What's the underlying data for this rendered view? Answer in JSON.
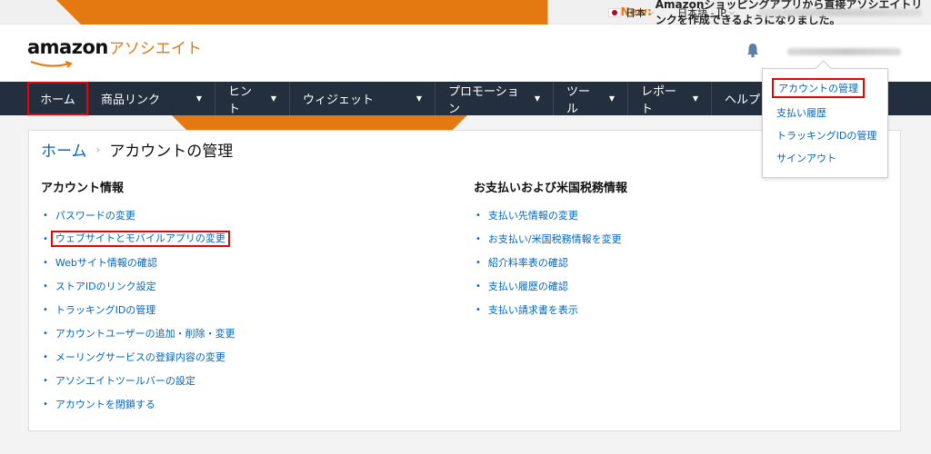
{
  "topbar": {
    "new_tag": "New:",
    "message": "Amazonショッピングアプリから直接アソシエイトリンクを作成できるようになりました。",
    "country": "日本",
    "language": "日本語 - JP"
  },
  "header": {
    "logo_text": "amazon",
    "logo_suffix": "アソシエイト"
  },
  "nav": {
    "home": "ホーム",
    "items": [
      "商品リンク",
      "ヒント",
      "ウィジェット",
      "プロモーション",
      "ツール",
      "レポート",
      "ヘルプ"
    ]
  },
  "breadcrumb": {
    "home": "ホーム",
    "separator": "›",
    "current": "アカウントの管理"
  },
  "account_info": {
    "heading": "アカウント情報",
    "links": [
      "パスワードの変更",
      "ウェブサイトとモバイルアプリの変更",
      "Webサイト情報の確認",
      "ストアIDのリンク設定",
      "トラッキングIDの管理",
      "アカウントユーザーの追加・削除・変更",
      "メーリングサービスの登録内容の変更",
      "アソシエイトツールバーの設定",
      "アカウントを閉鎖する"
    ]
  },
  "payment_info": {
    "heading": "お支払いおよび米国税務情報",
    "links": [
      "支払い先情報の変更",
      "お支払い/米国税務情報を変更",
      "紹介料率表の確認",
      "支払い履歴の確認",
      "支払い請求書を表示"
    ]
  },
  "account_menu": {
    "items": [
      "アカウントの管理",
      "支払い履歴",
      "トラッキングIDの管理",
      "サインアウト"
    ]
  },
  "colors": {
    "nav_bg": "#232f3e",
    "link": "#0066c0",
    "accent": "#e47911",
    "highlight_border": "#e00000"
  }
}
